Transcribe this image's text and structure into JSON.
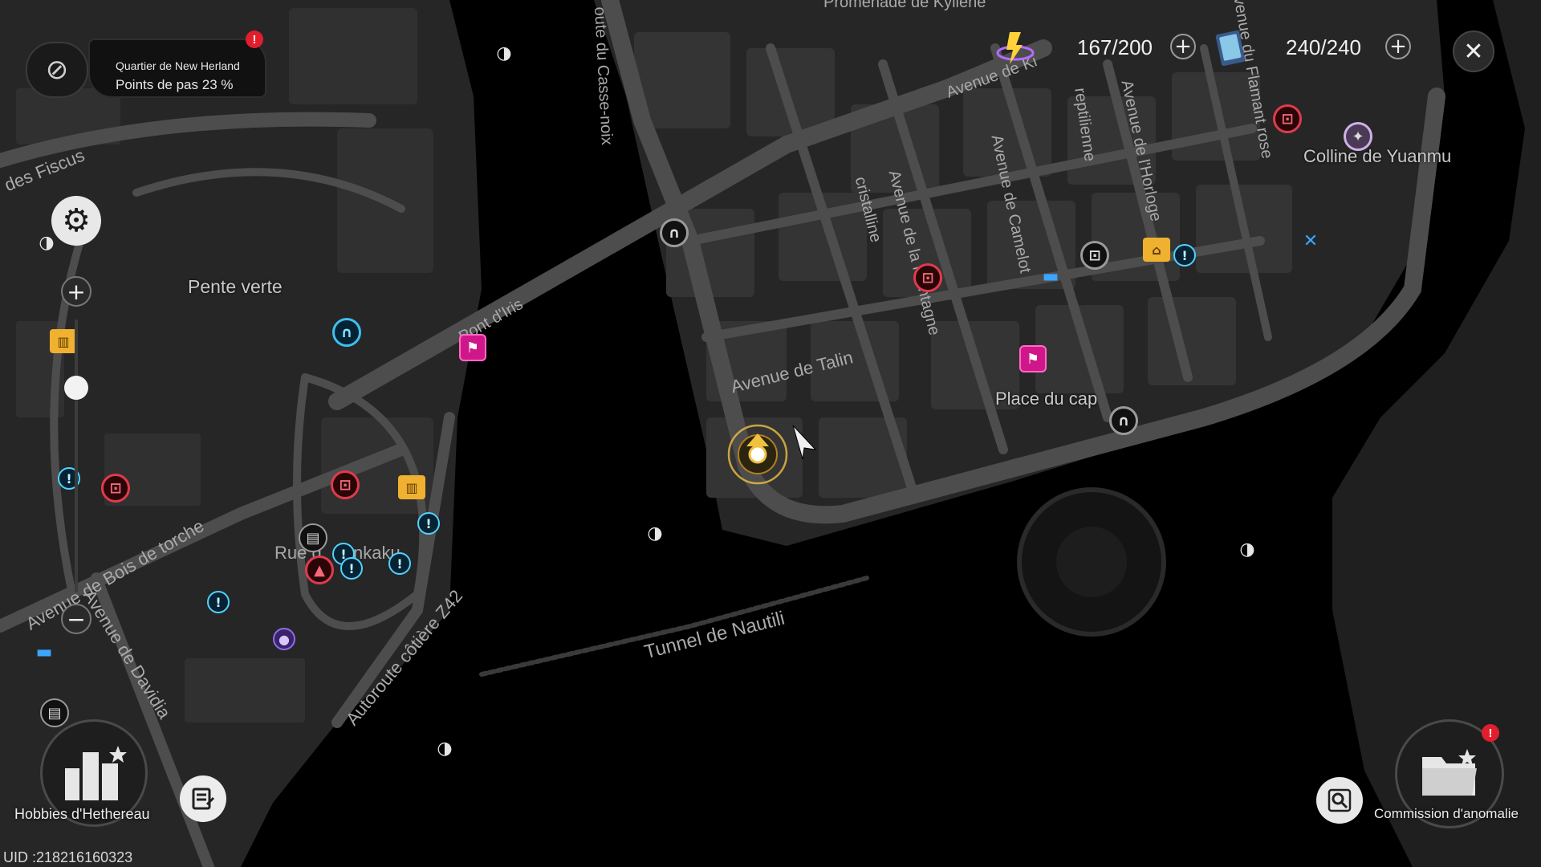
{
  "location": {
    "district": "Quartier de New Herland",
    "progress_text": "Points de pas 23 %",
    "alert": "!"
  },
  "resources": [
    {
      "icon": "battery-charge-icon",
      "value": "167/200",
      "add": "+"
    },
    {
      "icon": "card-pack-icon",
      "value": "240/240",
      "add": "+"
    }
  ],
  "close": "✕",
  "zoom": {
    "in": "+",
    "out": "−",
    "level": 0.25
  },
  "areas": {
    "pente_verte": "Pente verte",
    "collines": "Colline de Yuanmu",
    "place_cap": "Place du cap"
  },
  "streets": {
    "fiscus": "des Fiscus",
    "casse_noix": "oute du Casse-noix",
    "promenade": "Promenade de Kyllène",
    "avenue_ki": "Avenue de Ki",
    "reptilienne": "reptilienne",
    "horloge": "Avenue de l'Horloge",
    "flamant": "venue du Flamant rose",
    "cristalline": "cristalline",
    "montagne": "Avenue de la Montagne",
    "camelot": "Avenue de Camelot",
    "iris": "Pont d'Iris",
    "talin": "Avenue de Talin",
    "bois_torche": "Avenue de Bois de torche",
    "rue": "Rue d",
    "rue_tail": "nkaku",
    "davidia": "Avenue de Davidia",
    "autoroute": "Autoroute côtière Z42",
    "tunnel": "Tunnel de Nautili"
  },
  "buttons": {
    "settings": "⚙",
    "hobbies": "Hobbies d'Hethereau",
    "commission": "Commission d'anomalie",
    "commission_alert": "!"
  },
  "uid": "UID :218216160323",
  "colors": {
    "background": "#000000",
    "district_fill": "#2b2b2b",
    "road": "#4a4a4a",
    "commission_red": "#e03a4d",
    "info_blue": "#3ec0f0",
    "race_magenta": "#d0178a",
    "player_gold": "#f0c040"
  }
}
